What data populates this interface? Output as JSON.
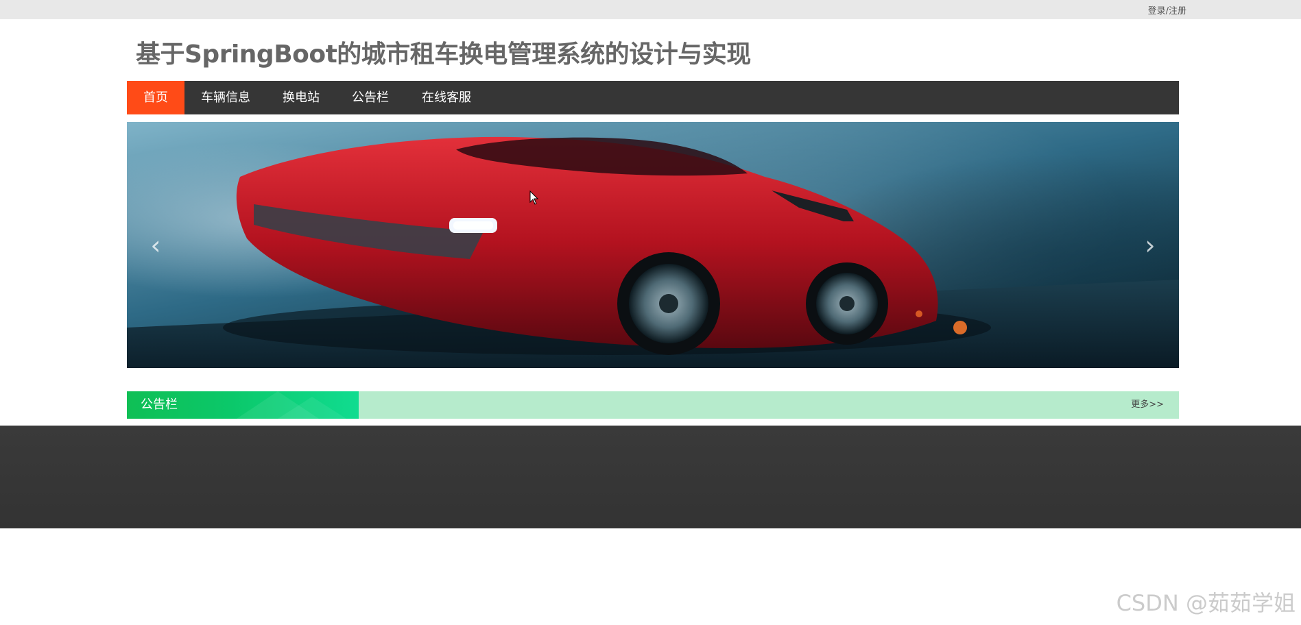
{
  "header": {
    "login_label": "登录/注册",
    "site_title": "基于SpringBoot的城市租车换电管理系统的设计与实现"
  },
  "nav": {
    "items": [
      {
        "label": "首页",
        "active": true
      },
      {
        "label": "车辆信息",
        "active": false
      },
      {
        "label": "换电站",
        "active": false
      },
      {
        "label": "公告栏",
        "active": false
      },
      {
        "label": "在线客服",
        "active": false
      }
    ]
  },
  "banner": {
    "prev_icon": "‹",
    "next_icon": "›"
  },
  "notice": {
    "title": "公告栏",
    "more_label": "更多>>"
  },
  "watermark": "CSDN @茹茹学姐",
  "colors": {
    "nav_bg": "#363636",
    "nav_active": "#ff4b17",
    "notice_title_bg": "#0bc86a",
    "notice_bar_bg": "#b6ebcc",
    "footer_bg": "#333333"
  }
}
